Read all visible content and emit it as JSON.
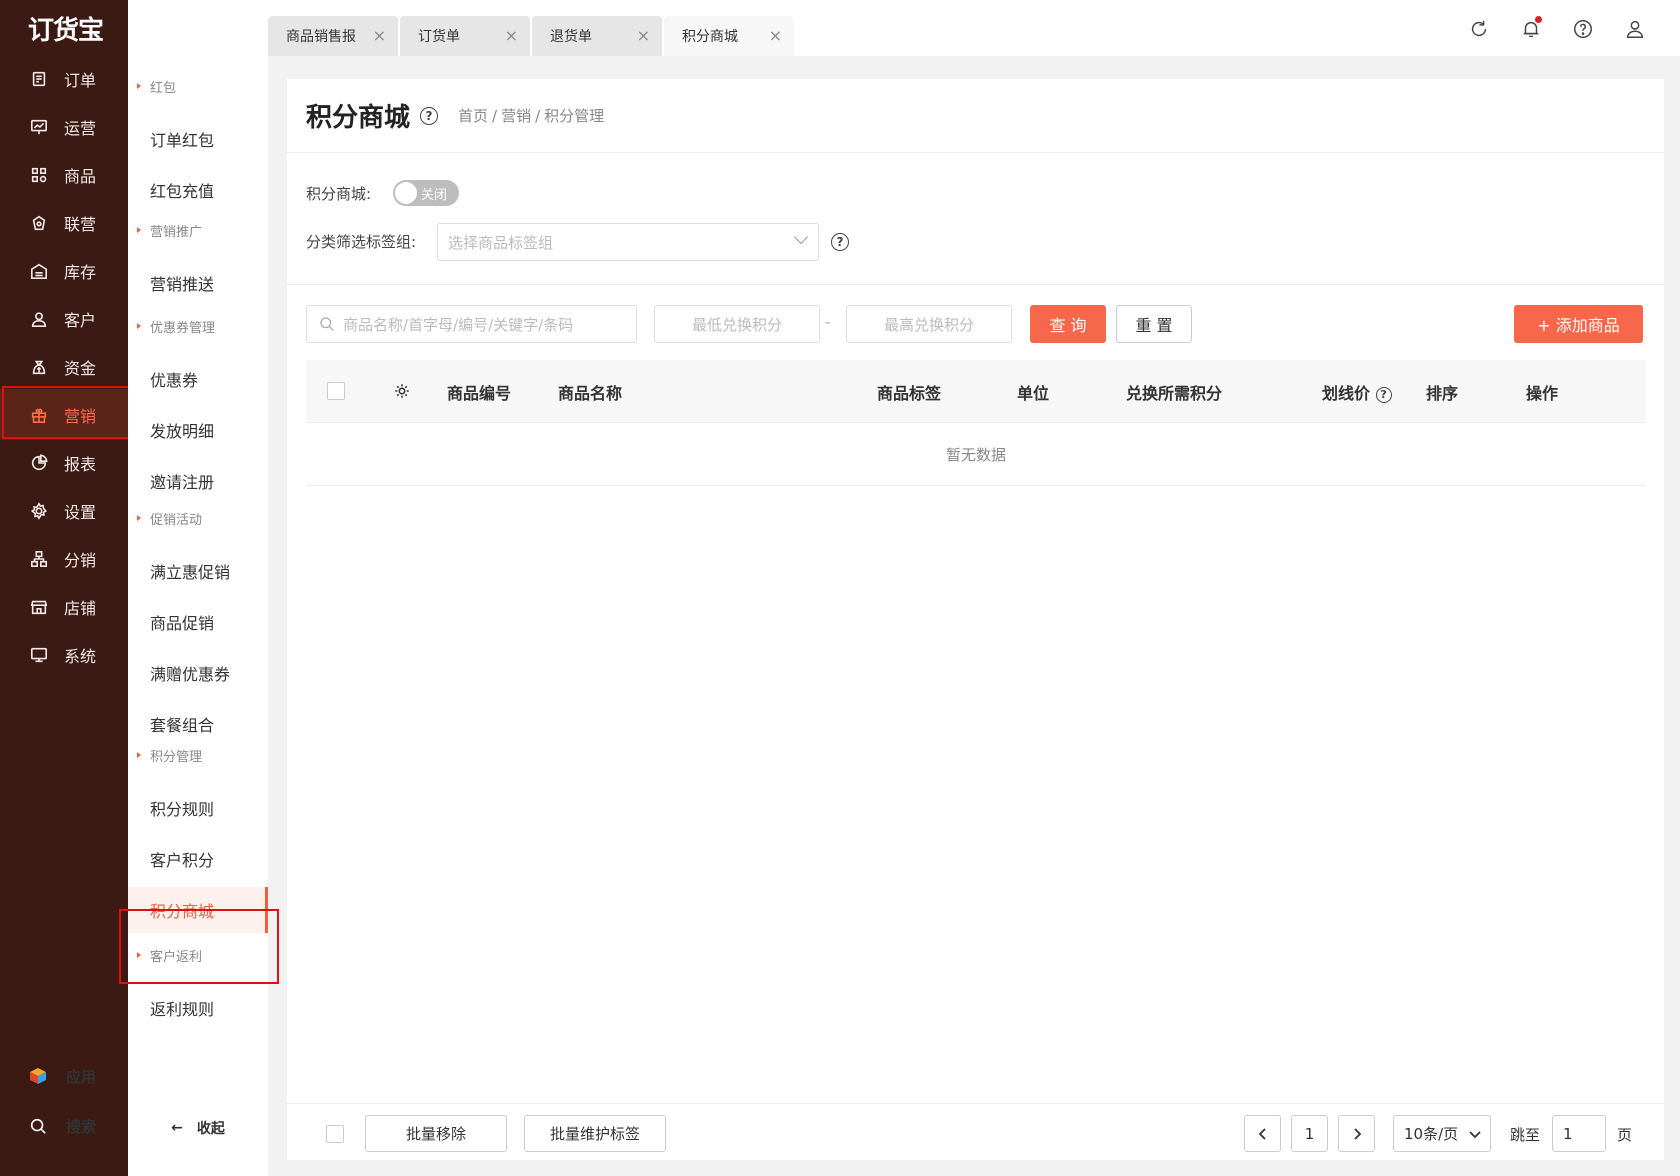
{
  "brand": {
    "logo_text": "订货宝"
  },
  "leftnav": {
    "items": [
      {
        "label": "订单",
        "icon": "order-icon"
      },
      {
        "label": "运营",
        "icon": "chart-board-icon"
      },
      {
        "label": "商品",
        "icon": "grid-icon"
      },
      {
        "label": "联营",
        "icon": "bag-icon"
      },
      {
        "label": "库存",
        "icon": "warehouse-icon"
      },
      {
        "label": "客户",
        "icon": "user-icon"
      },
      {
        "label": "资金",
        "icon": "money-bag-icon"
      },
      {
        "label": "营销",
        "icon": "gift-icon"
      },
      {
        "label": "报表",
        "icon": "pie-icon"
      },
      {
        "label": "设置",
        "icon": "gear-icon"
      },
      {
        "label": "分销",
        "icon": "network-icon"
      },
      {
        "label": "店铺",
        "icon": "store-icon"
      },
      {
        "label": "系统",
        "icon": "monitor-icon"
      }
    ],
    "active_index": 7,
    "apps_label": "应用",
    "search_label": "搜索"
  },
  "subnav": {
    "sections": [
      {
        "title": "红包",
        "items": [
          "订单红包",
          "红包充值"
        ]
      },
      {
        "title": "营销推广",
        "items": [
          "营销推送"
        ]
      },
      {
        "title": "优惠券管理",
        "items": [
          "优惠券",
          "发放明细",
          "邀请注册"
        ]
      },
      {
        "title": "促销活动",
        "items": [
          "满立惠促销",
          "商品促销",
          "满赠优惠券",
          "套餐组合"
        ]
      },
      {
        "title": "积分管理",
        "items": [
          "积分规则",
          "客户积分",
          "积分商城"
        ]
      },
      {
        "title": "客户返利",
        "items": [
          "返利规则"
        ]
      }
    ],
    "active_item": "积分商城",
    "collapse_label": "收起"
  },
  "tabs": [
    {
      "label": "商品销售报",
      "active": false
    },
    {
      "label": "订货单",
      "active": false
    },
    {
      "label": "退货单",
      "active": false
    },
    {
      "label": "积分商城",
      "active": true
    }
  ],
  "page": {
    "title": "积分商城",
    "breadcrumb": [
      "首页",
      "营销",
      "积分管理"
    ]
  },
  "filters": {
    "mall_label": "积分商城:",
    "switch_text": "关闭",
    "tag_group_label": "分类筛选标签组:",
    "tag_group_placeholder": "选择商品标签组",
    "search_placeholder": "商品名称/首字母/编号/关键字/条码",
    "min_points_placeholder": "最低兑换积分",
    "range_sep": "-",
    "max_points_placeholder": "最高兑换积分",
    "query_label": "查 询",
    "reset_label": "重 置",
    "add_label": "+ 添加商品"
  },
  "table": {
    "columns": [
      "商品编号",
      "商品名称",
      "商品标签",
      "单位",
      "兑换所需积分",
      "划线价",
      "排序",
      "操作"
    ],
    "empty_text": "暂无数据"
  },
  "footer": {
    "batch_remove": "批量移除",
    "batch_tags": "批量维护标签",
    "current_page": "1",
    "page_size": "10条/页",
    "jump_label": "跳至",
    "jump_value": "1",
    "page_suffix": "页"
  },
  "colors": {
    "accent": "#f7674a",
    "nav_bg": "#3b1a13"
  }
}
